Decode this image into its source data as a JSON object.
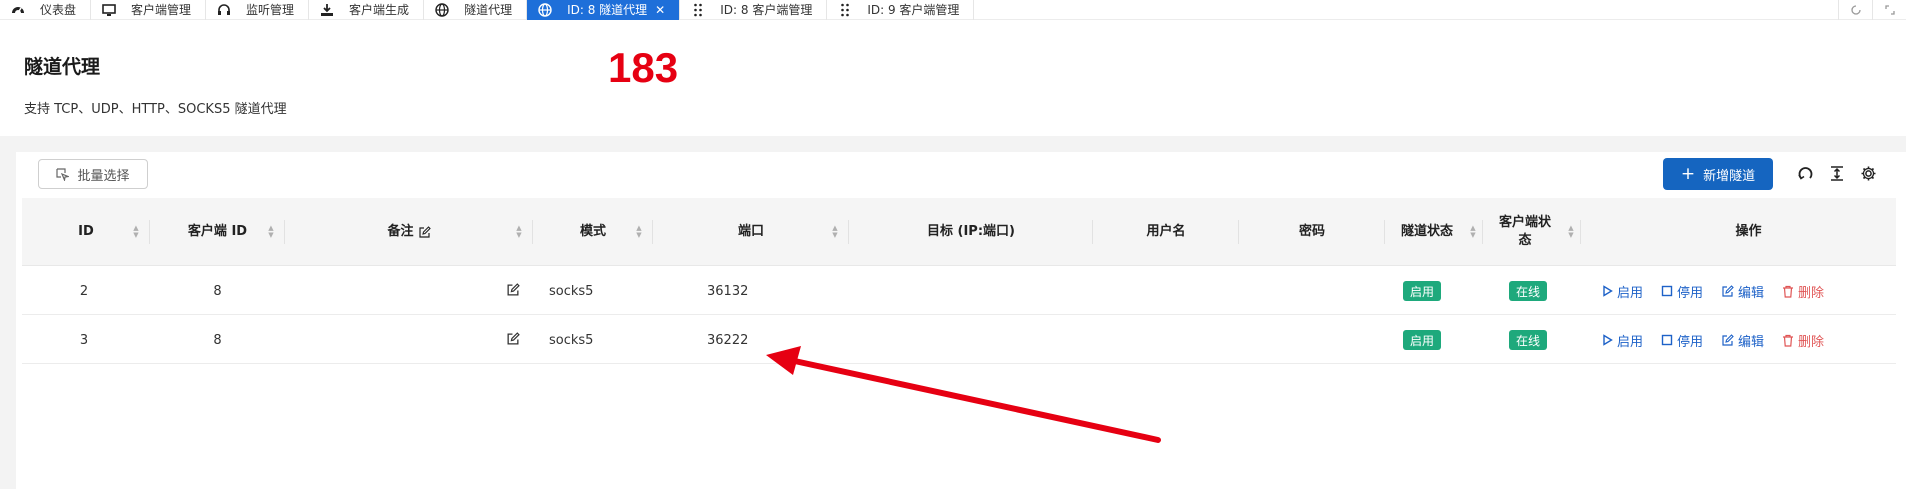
{
  "tabs": [
    {
      "label": "仪表盘",
      "icon": "dashboard-icon",
      "active": false
    },
    {
      "label": "客户端管理",
      "icon": "monitor-icon",
      "active": false
    },
    {
      "label": "监听管理",
      "icon": "headphones-icon",
      "active": false
    },
    {
      "label": "客户端生成",
      "icon": "download-icon",
      "active": false
    },
    {
      "label": "隧道代理",
      "icon": "globe-icon",
      "active": false
    },
    {
      "label": "ID: 8 隧道代理",
      "icon": "globe-icon",
      "active": true
    },
    {
      "label": "ID: 8 客户端管理",
      "icon": "drag-handle-icon",
      "active": false
    },
    {
      "label": "ID: 9 客户端管理",
      "icon": "drag-handle-icon",
      "active": false
    }
  ],
  "page": {
    "title": "隧道代理",
    "description": "支持 TCP、UDP、HTTP、SOCKS5 隧道代理",
    "annotation_number": "183"
  },
  "toolbar": {
    "batch_select_label": "批量选择",
    "add_tunnel_label": "新增隧道"
  },
  "table": {
    "headers": {
      "id": "ID",
      "client_id": "客户端 ID",
      "remark": "备注",
      "mode": "模式",
      "port": "端口",
      "target": "目标 (IP:端口)",
      "username": "用户名",
      "password": "密码",
      "tunnel_status": "隧道状态",
      "client_status_line1": "客户端状",
      "client_status_line2": "态",
      "actions": "操作"
    },
    "rows": [
      {
        "id": "2",
        "client_id": "8",
        "remark": "",
        "mode": "socks5",
        "port": "36132",
        "target": "",
        "username": "",
        "password": "",
        "tunnel_status": "启用",
        "client_status": "在线"
      },
      {
        "id": "3",
        "client_id": "8",
        "remark": "",
        "mode": "socks5",
        "port": "36222",
        "target": "",
        "username": "",
        "password": "",
        "tunnel_status": "启用",
        "client_status": "在线"
      }
    ],
    "actions": {
      "enable": "启用",
      "disable": "停用",
      "edit": "编辑",
      "delete": "删除"
    }
  },
  "colors": {
    "primary": "#1565c0",
    "active_tab": "#1e6fd9",
    "status_tag": "#1ea97c",
    "danger": "#e05555",
    "annotation": "#e60012"
  }
}
